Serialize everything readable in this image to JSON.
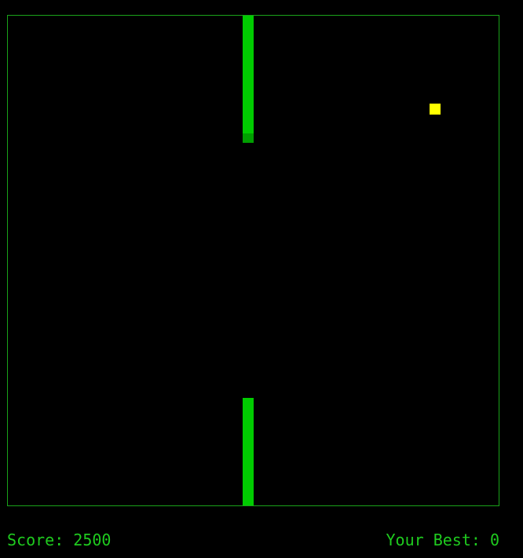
{
  "game": {
    "colors": {
      "background": "#000000",
      "border": "#1aa31a",
      "snake": "#00cc00",
      "snake_tail": "#009f00",
      "food": "#ffff00",
      "hud_text": "#1fcb1f"
    }
  },
  "hud": {
    "score_label": "Score: 2500",
    "best_label": "Your Best: 0"
  }
}
